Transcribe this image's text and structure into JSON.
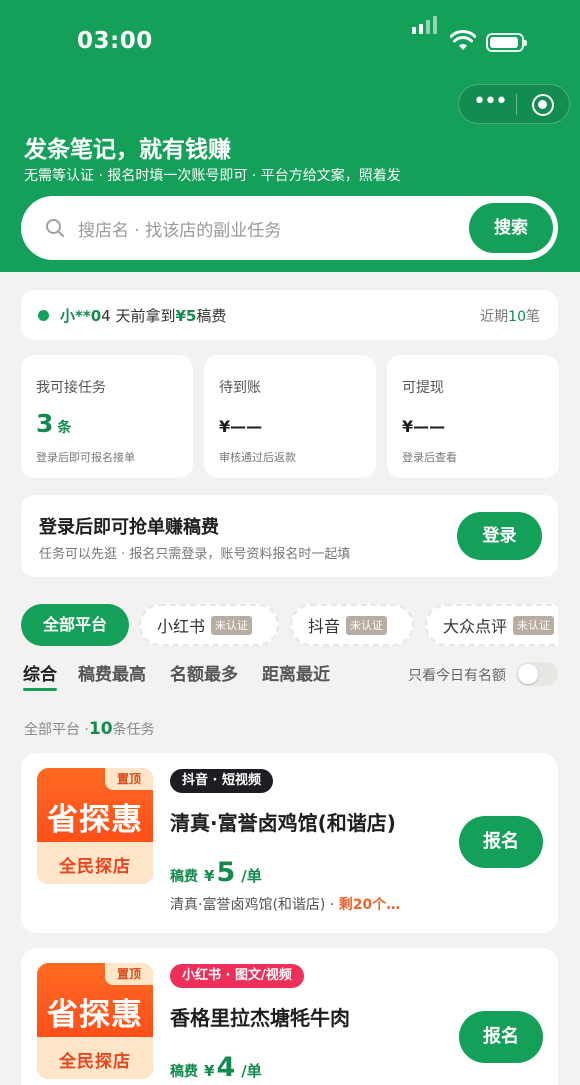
{
  "status_bar": {
    "time": "03:00"
  },
  "capsule": {
    "more_icon": "more-dots-icon",
    "close_icon": "target-circle-icon"
  },
  "hero": {
    "title": "发条笔记，就有钱赚",
    "subtitle": "无需等认证 · 报名时填一次账号即可 · 平台方给文案，照着发"
  },
  "search": {
    "placeholder": "搜店名 · 找该店的副业任务",
    "button": "搜索"
  },
  "ticker": {
    "user": "小**0",
    "message_mid": "4 天前拿到",
    "amount": "¥5",
    "message_end": "稿费",
    "recent_prefix": "近期",
    "recent_count": "10",
    "recent_suffix": "笔"
  },
  "stats": [
    {
      "label": "我可接任务",
      "value": "3",
      "unit": "条",
      "hint": "登录后即可报名接单"
    },
    {
      "label": "待到账",
      "value": "¥——",
      "hint": "审核通过后返款"
    },
    {
      "label": "可提现",
      "value": "¥——",
      "hint": "登录后查看"
    }
  ],
  "login_card": {
    "title": "登录后即可抢单赚稿费",
    "subtitle": "任务可以先逛 · 报名只需登录，账号资料报名时一起填",
    "button": "登录"
  },
  "platform_chips": [
    {
      "label": "全部平台",
      "badge": "",
      "active": true
    },
    {
      "label": "小红书",
      "badge": "未认证",
      "active": false
    },
    {
      "label": "抖音",
      "badge": "未认证",
      "active": false
    },
    {
      "label": "大众点评",
      "badge": "未认证",
      "active": false
    }
  ],
  "sort_tabs": [
    "综合",
    "稿费最高",
    "名额最多",
    "距离最近"
  ],
  "today_toggle": {
    "label": "只看今日有名额",
    "on": false
  },
  "task_count": {
    "prefix": "全部平台 ·",
    "count": "10",
    "suffix": "条任务"
  },
  "tasks": [
    {
      "pin": "置顶",
      "brand": "省探惠",
      "slogan": "全民探店",
      "tag": "抖音 · 短视频",
      "tag_color": "#1f1d22",
      "name": "清真·富誉卤鸡馆(和谐店)",
      "fee_label": "稿费",
      "currency": "¥",
      "fee": "5",
      "per": "/单",
      "shop": "清真·富誉卤鸡馆(和谐店) ·",
      "remaining": "剩20个…",
      "button": "报名"
    },
    {
      "pin": "置顶",
      "brand": "省探惠",
      "slogan": "全民探店",
      "tag": "小红书 · 图文/视频",
      "tag_color": "#ee2f5a",
      "name": "香格里拉杰塘牦牛肉",
      "fee_label": "稿费",
      "currency": "¥",
      "fee": "4",
      "per": "/单",
      "shop": "",
      "remaining": "",
      "button": "报名"
    }
  ],
  "colors": {
    "brand_green": "#15a05a",
    "accent_orange": "#f0632a"
  }
}
